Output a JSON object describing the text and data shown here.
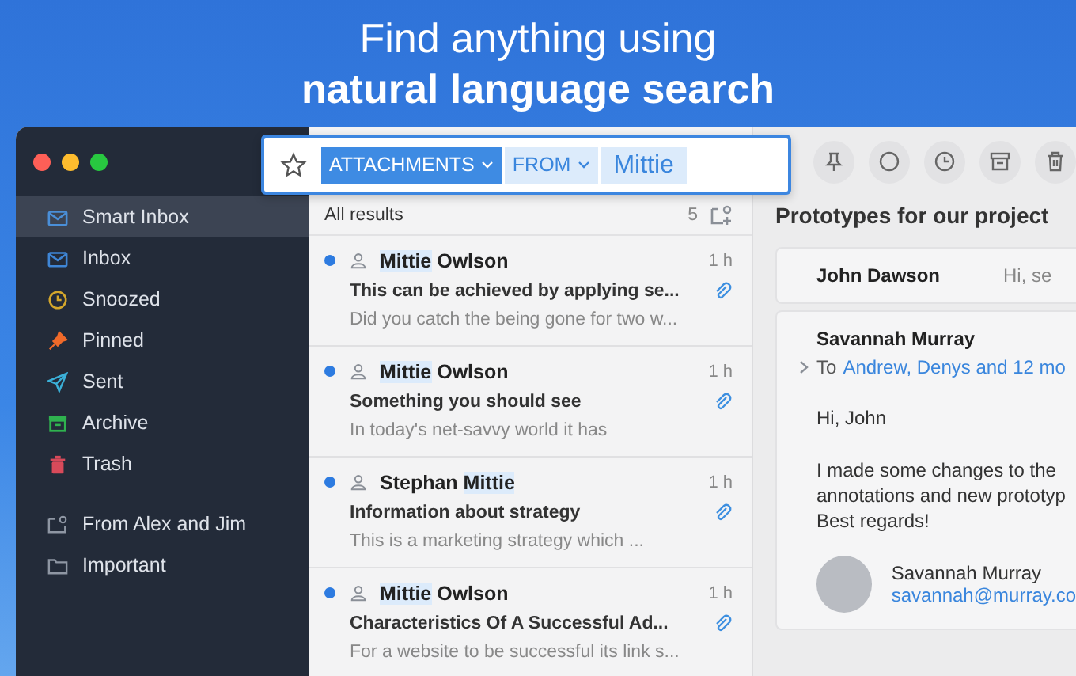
{
  "headline": {
    "line1": "Find anything using",
    "line2": "natural language search"
  },
  "search": {
    "chips": [
      {
        "label": "ATTACHMENTS",
        "kind": "filter",
        "selected": true
      },
      {
        "label": "FROM",
        "kind": "filter",
        "selected": false
      }
    ],
    "value": "Mittie"
  },
  "sidebar": {
    "items": [
      {
        "label": "Smart Inbox",
        "kind": "smart",
        "selected": true
      },
      {
        "label": "Inbox",
        "kind": "inbox",
        "selected": false
      },
      {
        "label": "Snoozed",
        "kind": "snoozed",
        "selected": false
      },
      {
        "label": "Pinned",
        "kind": "pinned",
        "selected": false
      },
      {
        "label": "Sent",
        "kind": "sent",
        "selected": false
      },
      {
        "label": "Archive",
        "kind": "archive",
        "selected": false
      },
      {
        "label": "Trash",
        "kind": "trash",
        "selected": false
      }
    ],
    "folders": [
      {
        "label": "From Alex and Jim",
        "kind": "smartfolder"
      },
      {
        "label": "Important",
        "kind": "folder"
      }
    ]
  },
  "list": {
    "header": "All results",
    "count": "5",
    "rows": [
      {
        "sender": [
          {
            "text": "Mittie",
            "highlight": true
          },
          {
            "text": " Owlson",
            "highlight": false
          }
        ],
        "time": "1 h",
        "subject": "This can be achieved by applying se...",
        "preview": "Did you catch the being gone for two w...",
        "unread": true,
        "attachment": true
      },
      {
        "sender": [
          {
            "text": "Mittie",
            "highlight": true
          },
          {
            "text": " Owlson",
            "highlight": false
          }
        ],
        "time": "1 h",
        "subject": "Something you should see",
        "preview": "In today's net-savvy world it has",
        "unread": true,
        "attachment": true
      },
      {
        "sender": [
          {
            "text": "Stephan ",
            "highlight": false
          },
          {
            "text": "Mittie",
            "highlight": true
          }
        ],
        "time": "1 h",
        "subject": "Information about strategy",
        "preview": "This is a marketing strategy which ...",
        "unread": true,
        "attachment": true
      },
      {
        "sender": [
          {
            "text": "Mittie",
            "highlight": true
          },
          {
            "text": " Owlson",
            "highlight": false
          }
        ],
        "time": "1 h",
        "subject": "Characteristics Of A Successful Ad...",
        "preview": "For a website to be successful its link s...",
        "unread": true,
        "attachment": true
      }
    ]
  },
  "reader": {
    "subject": "Prototypes for our project",
    "collapsed": {
      "sender": "John Dawson",
      "snippet": "Hi, se"
    },
    "message": {
      "sender": "Savannah Murray",
      "to_label": "To",
      "recipients": "Andrew, Denys and 12 mo",
      "greeting": "Hi, John",
      "body": "I made some changes to the",
      "body2": "annotations and new prototyp",
      "closing": "Best regards!",
      "signature_name": "Savannah Murray",
      "signature_email": "savannah@murray.co"
    }
  }
}
